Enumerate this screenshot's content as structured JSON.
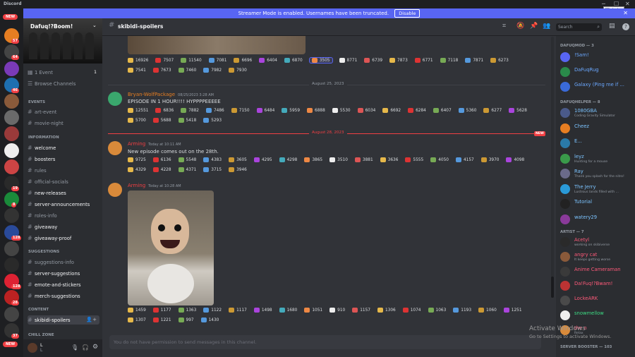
{
  "app": {
    "title": "Discord",
    "minimize_tooltip": "Minimize"
  },
  "banner": {
    "text": "Streamer Mode is enabled. Usernames have been truncated.",
    "button": "Disable"
  },
  "guild_badges": [
    "NEW",
    "57",
    "64",
    "",
    "46",
    "",
    "",
    "",
    "",
    "",
    "19",
    "8",
    "",
    "128",
    "",
    "",
    "128",
    "28",
    "",
    "37",
    "NEW"
  ],
  "server": {
    "name": "Dafuq!?Boom!",
    "events": {
      "label": "1 Event",
      "count": "1"
    },
    "browse": "Browse Channels",
    "categories": {
      "events": "EVENTS",
      "information": "INFORMATION",
      "suggestions": "SUGGESTIONS",
      "content": "CONTENT",
      "chill": "CHILL ZONE"
    },
    "channels_events": [
      "art-event",
      "movie-night"
    ],
    "channels_info": [
      "welcome",
      "boosters",
      "rules",
      "official-socials",
      "new-releases",
      "server-announcements",
      "roles-info",
      "giveaway",
      "giveaway-proof"
    ],
    "channels_sugg": [
      "suggestions-info",
      "server-suggestions",
      "emote-and-stickers",
      "merch-suggestions"
    ],
    "channels_content": [
      "skibidi-spoilers"
    ]
  },
  "user": {
    "name": "L",
    "sub": "L"
  },
  "header": {
    "channel": "skibidi-spoilers",
    "search_placeholder": "Search"
  },
  "messages": {
    "top_reactions_row1": [
      "16926",
      "7507",
      "11540",
      "7081",
      "6696",
      "6404",
      "6870",
      "3505",
      "8771",
      "6739",
      "7873",
      "6771",
      "7118",
      "7871",
      "6273"
    ],
    "top_reactions_row2": [
      "7541",
      "7673",
      "7460",
      "7982",
      "7930"
    ],
    "date1": "August 25, 2023",
    "m1": {
      "author": "Bryan-WolfPackage",
      "time": "08/25/2023 3:28 AM",
      "text": "EPISODE IN 1 HOUR!!!! HYPPPPEEEEE",
      "reactions1": [
        "12551",
        "6836",
        "7882",
        "7486",
        "7150",
        "6484",
        "5959",
        "6888",
        "5530",
        "6034",
        "6692",
        "6284",
        "6407",
        "5360",
        "6277",
        "5628"
      ],
      "reactions2": [
        "5700",
        "5688",
        "5418",
        "5293"
      ]
    },
    "date2": "August 28, 2023",
    "new_label": "NEW",
    "m2": {
      "author": "Arming",
      "time": "Today at 10:11 AM",
      "text": "New episode comes out on the 28th.",
      "reactions1": [
        "9725",
        "6136",
        "5548",
        "4383",
        "3605",
        "4295",
        "4298",
        "3865",
        "3510",
        "3881",
        "3636",
        "5555",
        "4050",
        "4157",
        "3970",
        "4098"
      ],
      "reactions2": [
        "4329",
        "4228",
        "4371",
        "3715",
        "3946"
      ]
    },
    "m3": {
      "author": "Arming",
      "time": "Today at 10:28 AM",
      "reactions1": [
        "1459",
        "1177",
        "1363",
        "1122",
        "1117",
        "1498",
        "1680",
        "1051",
        "910",
        "1157",
        "1306",
        "1074",
        "1063",
        "1193",
        "1060",
        "1251"
      ],
      "reactions2": [
        "1307",
        "1221",
        "997",
        "1430"
      ]
    }
  },
  "input_placeholder": "You do not have permission to send messages in this channel.",
  "members": {
    "cat1": "DAFUQMOD — 3",
    "mods": [
      {
        "name": "!Sam!",
        "color": "#6ba8ff"
      },
      {
        "name": "DaFuqRug",
        "color": "#6ba8ff"
      },
      {
        "name": "Galaxy (Ping me if ...",
        "color": "#6ba8ff"
      }
    ],
    "cat2": "DAFUQHELPER — 8",
    "helpers": [
      {
        "name": "1080GBA",
        "status": "Coding Gravity Simulator",
        "color": "#7cc4ff"
      },
      {
        "name": "Cheez",
        "status": "",
        "color": "#7cc4ff"
      },
      {
        "name": "E...",
        "status": "",
        "color": "#7cc4ff"
      },
      {
        "name": "leyz",
        "status": "Hunting for a mouse",
        "color": "#7cc4ff"
      },
      {
        "name": "Ray",
        "status": "Thank you splash for the nitro!",
        "color": "#7cc4ff"
      },
      {
        "name": "The Jerry",
        "status": "Lustrous lands filled with ...",
        "color": "#7cc4ff"
      },
      {
        "name": "Tutorial",
        "status": "",
        "color": "#7cc4ff"
      },
      {
        "name": "watery29",
        "status": "",
        "color": "#7cc4ff"
      }
    ],
    "cat3": "ARTIST — 7",
    "artists": [
      {
        "name": "Acetyl",
        "status": "working on skibiverse",
        "color": "#ff5a7a"
      },
      {
        "name": "angry cat",
        "status": "It keeps getting worse",
        "color": "#ff5a7a"
      },
      {
        "name": "Anime Cameraman",
        "status": "",
        "color": "#ff5a7a"
      },
      {
        "name": "Da!Fuq!?Bwam!",
        "status": "",
        "color": "#ff5a7a"
      },
      {
        "name": "LockeARK",
        "status": "",
        "color": "#ff5a7a"
      },
      {
        "name": "snowmellow",
        "status": "",
        "color": "#3ddc84"
      },
      {
        "name": "the n",
        "status": "Relax",
        "color": "#ff5a7a"
      }
    ],
    "cat4": "SERVER BOOSTER — 103"
  },
  "windows": {
    "line1": "Activate Windows",
    "line2": "Go to Settings to activate Windows."
  },
  "colors": {
    "accent": "#5865f2",
    "red": "#f23f43",
    "bg": "#313338"
  }
}
